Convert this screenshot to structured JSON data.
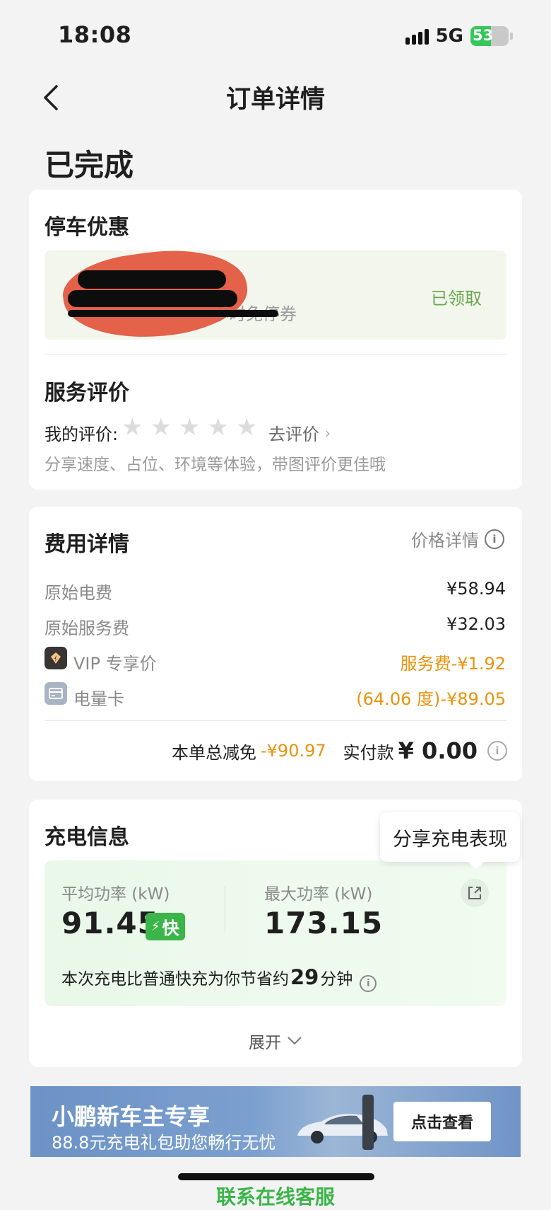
{
  "status_bar": {
    "time": "18:08",
    "network": "5G",
    "battery": "53",
    "battery_level": 0.53
  },
  "nav": {
    "title": "订单详情"
  },
  "order_status": "已完成",
  "parking": {
    "title": "停车优惠",
    "coupon_text": "小时免停券",
    "coupon_status": "已领取"
  },
  "review": {
    "title": "服务评价",
    "label": "我的评价:",
    "stars_total": 5,
    "stars_filled": 0,
    "action": "去评价",
    "hint": "分享速度、占位、环境等体验，带图评价更佳哦"
  },
  "fees": {
    "title": "费用详情",
    "price_detail": "价格详情",
    "rows": [
      {
        "label": "原始电费",
        "value": "¥58.94"
      },
      {
        "label": "原始服务费",
        "value": "¥32.03"
      },
      {
        "label": "VIP 专享价",
        "value": "服务费-¥1.92"
      },
      {
        "label": "电量卡",
        "value": "(64.06 度)-¥89.05"
      }
    ],
    "discount_label": "本单总减免",
    "discount_value": "-¥90.97",
    "paid_label": "实付款",
    "paid_value": "¥ 0.00"
  },
  "charging": {
    "title": "充电信息",
    "share_tooltip": "分享充电表现",
    "avg_power_label": "平均功率 (kW)",
    "avg_power_value": "91.45",
    "fast_badge": "快",
    "max_power_label": "最大功率 (kW)",
    "max_power_value": "173.15",
    "saving_prefix": "本次充电比普通快充为你节省约",
    "saving_minutes": "29",
    "saving_suffix": "分钟",
    "expand": "展开"
  },
  "banner": {
    "title": "小鹏新车主专享",
    "subtitle": "88.8元充电礼包助您畅行无忧",
    "button": "点击查看"
  },
  "footer": {
    "contact": "联系在线客服"
  },
  "colors": {
    "accent_green": "#3bb54a",
    "accent_orange": "#e8930c",
    "status_green": "#6aa84f"
  }
}
